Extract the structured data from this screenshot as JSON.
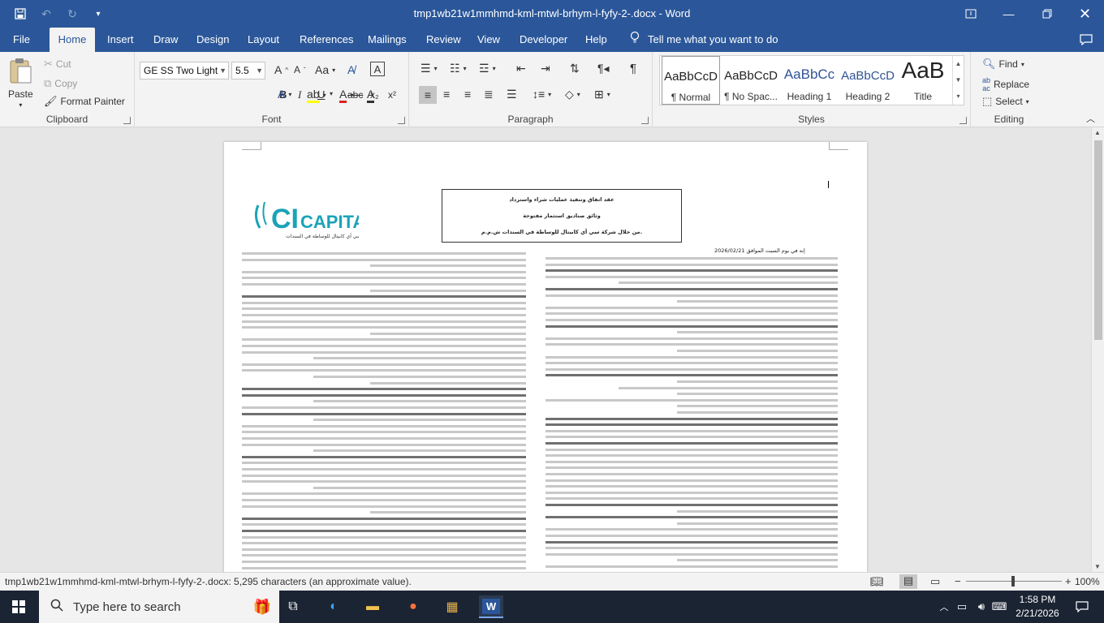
{
  "window": {
    "title": "tmp1wb21w1mmhmd-kml-mtwl-brhym-l-fyfy-2-.docx  -  Word",
    "save_icon": "save-icon",
    "undo_icon": "undo-icon",
    "redo_icon": "redo-icon"
  },
  "tabs": [
    "File",
    "Home",
    "Insert",
    "Draw",
    "Design",
    "Layout",
    "References",
    "Mailings",
    "Review",
    "View",
    "Developer",
    "Help"
  ],
  "active_tab": "Home",
  "tell_me": "Tell me what you want to do",
  "ribbon": {
    "clipboard": {
      "paste": "Paste",
      "cut": "Cut",
      "copy": "Copy",
      "format_painter": "Format Painter",
      "label": "Clipboard"
    },
    "font": {
      "name": "GE SS Two Light",
      "size": "5.5",
      "label": "Font",
      "bold": "B",
      "italic": "I",
      "underline": "U",
      "strike": "abc",
      "subscript": "x₂",
      "superscript": "x²",
      "grow": "A",
      "shrink": "A",
      "case": "Aa"
    },
    "paragraph": {
      "label": "Paragraph"
    },
    "styles": {
      "label": "Styles",
      "items": [
        {
          "sample": "AaBbCcD",
          "name": "¶ Normal"
        },
        {
          "sample": "AaBbCcD",
          "name": "¶ No Spac..."
        },
        {
          "sample": "AaBbCc",
          "name": "Heading 1"
        },
        {
          "sample": "AaBbCcD",
          "name": "Heading 2"
        },
        {
          "sample": "AaB",
          "name": "Title"
        }
      ]
    },
    "editing": {
      "find": "Find",
      "replace": "Replace",
      "select": "Select",
      "label": "Editing"
    }
  },
  "document": {
    "header_lines": [
      "عقد اتفاق وتنفيذ عمليات شراء واسترداد",
      "وثائق صناديق استثمار مفتوحة",
      "من خلال شركة سي أي كابيتال للوساطة في السندات ش.م.م."
    ],
    "logo_text": "CI CAPITAL",
    "logo_subtitle": "سي آي كابيتال للوساطة في السندات",
    "date_line": "إنه في يوم السبت الموافق 2026/02/21"
  },
  "status": {
    "text": "tmp1wb21w1mmhmd-kml-mtwl-brhym-l-fyfy-2-.docx: 5,295 characters (an approximate value).",
    "zoom": "100%"
  },
  "taskbar": {
    "search_placeholder": "Type here to search",
    "time": "1:58 PM",
    "date": "2/21/2026"
  },
  "colors": {
    "accent": "#2b579a",
    "logo": "#1aa3b8"
  }
}
